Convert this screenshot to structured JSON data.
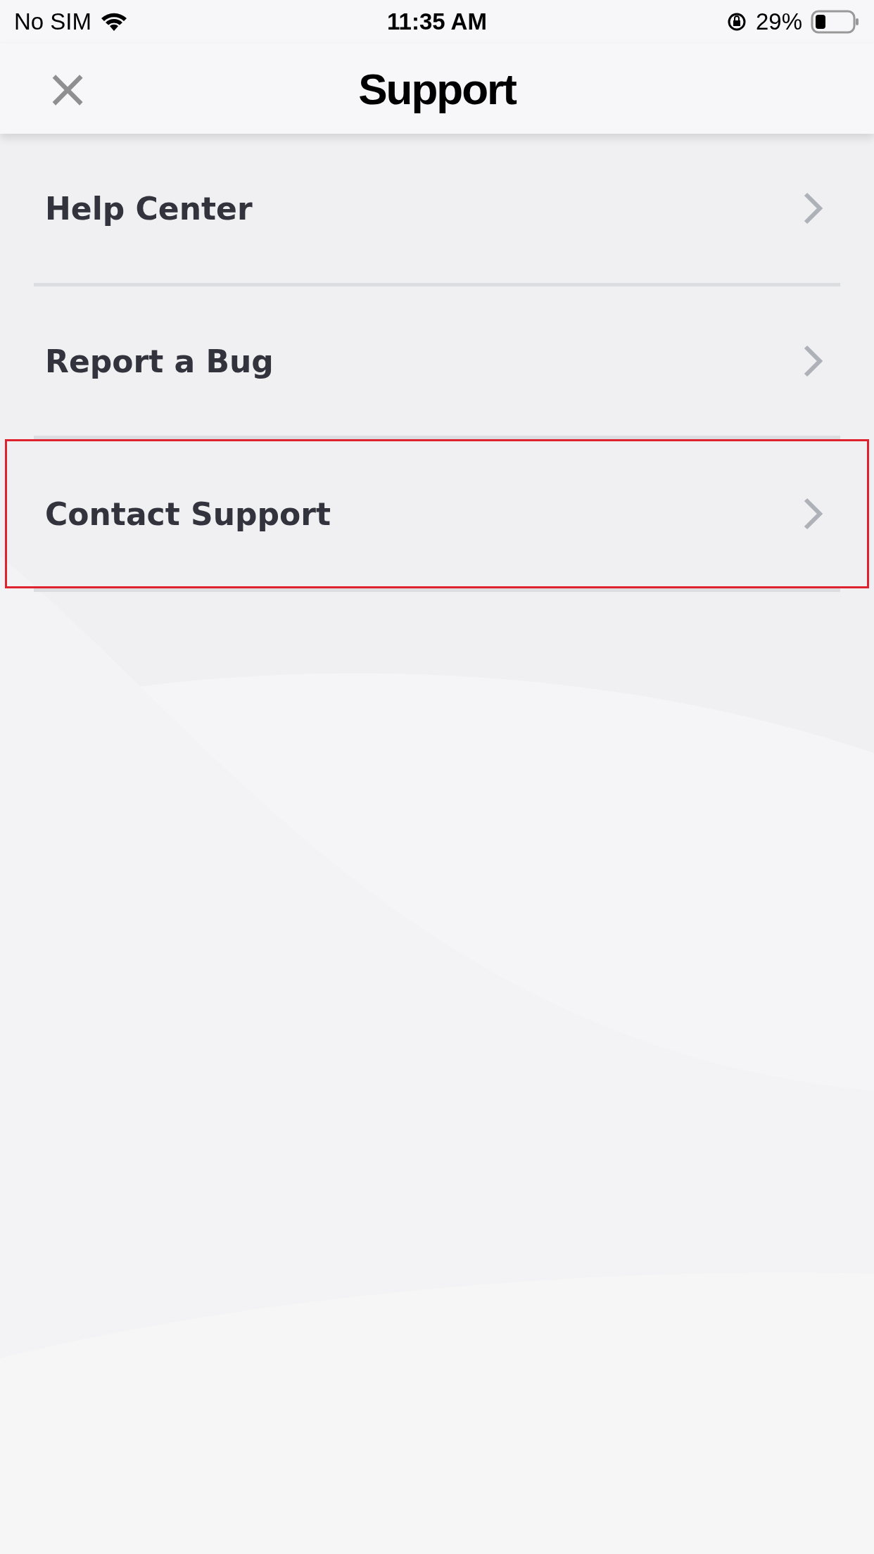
{
  "status_bar": {
    "carrier": "No SIM",
    "time": "11:35 AM",
    "battery_percent": "29%"
  },
  "header": {
    "close": "×",
    "title": "Support"
  },
  "items": [
    {
      "label": "Help Center",
      "highlighted": false
    },
    {
      "label": "Report a Bug",
      "highlighted": false
    },
    {
      "label": "Contact Support",
      "highlighted": true
    }
  ]
}
